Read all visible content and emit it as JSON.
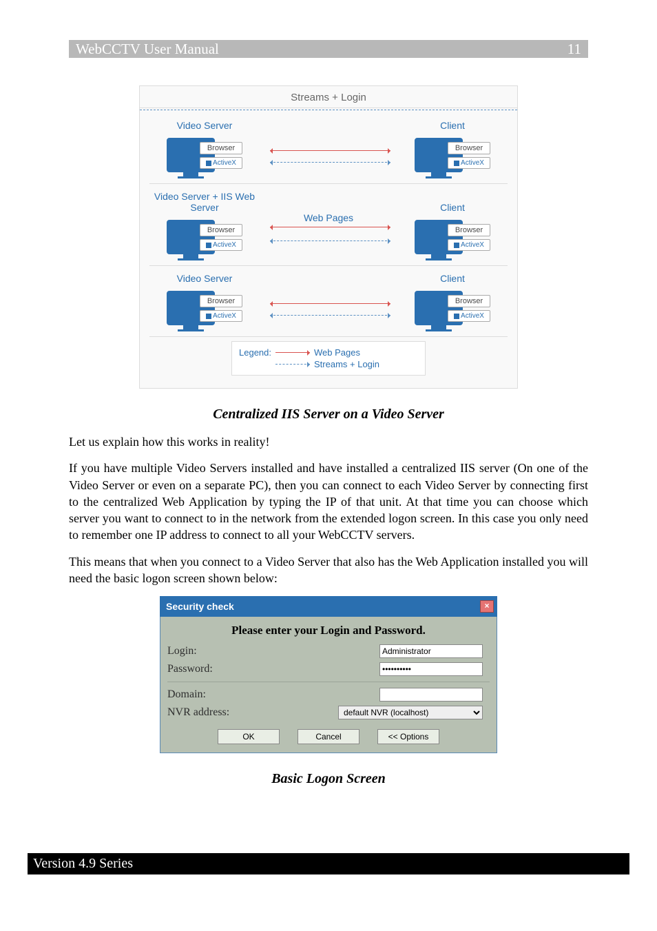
{
  "header": {
    "title": "WebCCTV User Manual",
    "page_number": "11"
  },
  "diagram": {
    "top_label": "Streams + Login",
    "rows": [
      {
        "left": "Video Server",
        "mid": "",
        "right": "Client"
      },
      {
        "left": "Video Server + IIS Web Server",
        "mid": "Web Pages",
        "right": "Client"
      },
      {
        "left": "Video Server",
        "mid": "",
        "right": "Client"
      }
    ],
    "chip_browser": "Browser",
    "chip_activex": "ActiveX",
    "legend_label": "Legend:",
    "legend_web": "Web Pages",
    "legend_streams": "Streams + Login"
  },
  "caption1": "Centralized IIS Server on a Video Server",
  "para1": "Let us explain how this works in reality!",
  "para2": "If you have multiple Video Servers installed and have installed a centralized IIS server (On one of the Video Server or even on a separate PC), then you can connect to each Video Server by connecting first to the centralized Web Application by typing the IP of that unit. At that time you can choose which server you want to connect to in the network from the extended logon screen. In this case you only need to remember one IP address to connect to all your WebCCTV servers.",
  "para3": "This means that when you connect to a Video Server that also has the Web Application installed you will need the basic logon screen shown below:",
  "login": {
    "title": "Security check",
    "instruction": "Please enter your Login and Password.",
    "login_label": "Login:",
    "login_value": "Administrator",
    "password_label": "Password:",
    "password_value": "••••••••••",
    "domain_label": "Domain:",
    "domain_value": "",
    "nvr_label": "NVR address:",
    "nvr_value": "default NVR (localhost)",
    "ok": "OK",
    "cancel": "Cancel",
    "options": "<< Options"
  },
  "caption2": "Basic Logon Screen",
  "footer": "Version 4.9 Series"
}
